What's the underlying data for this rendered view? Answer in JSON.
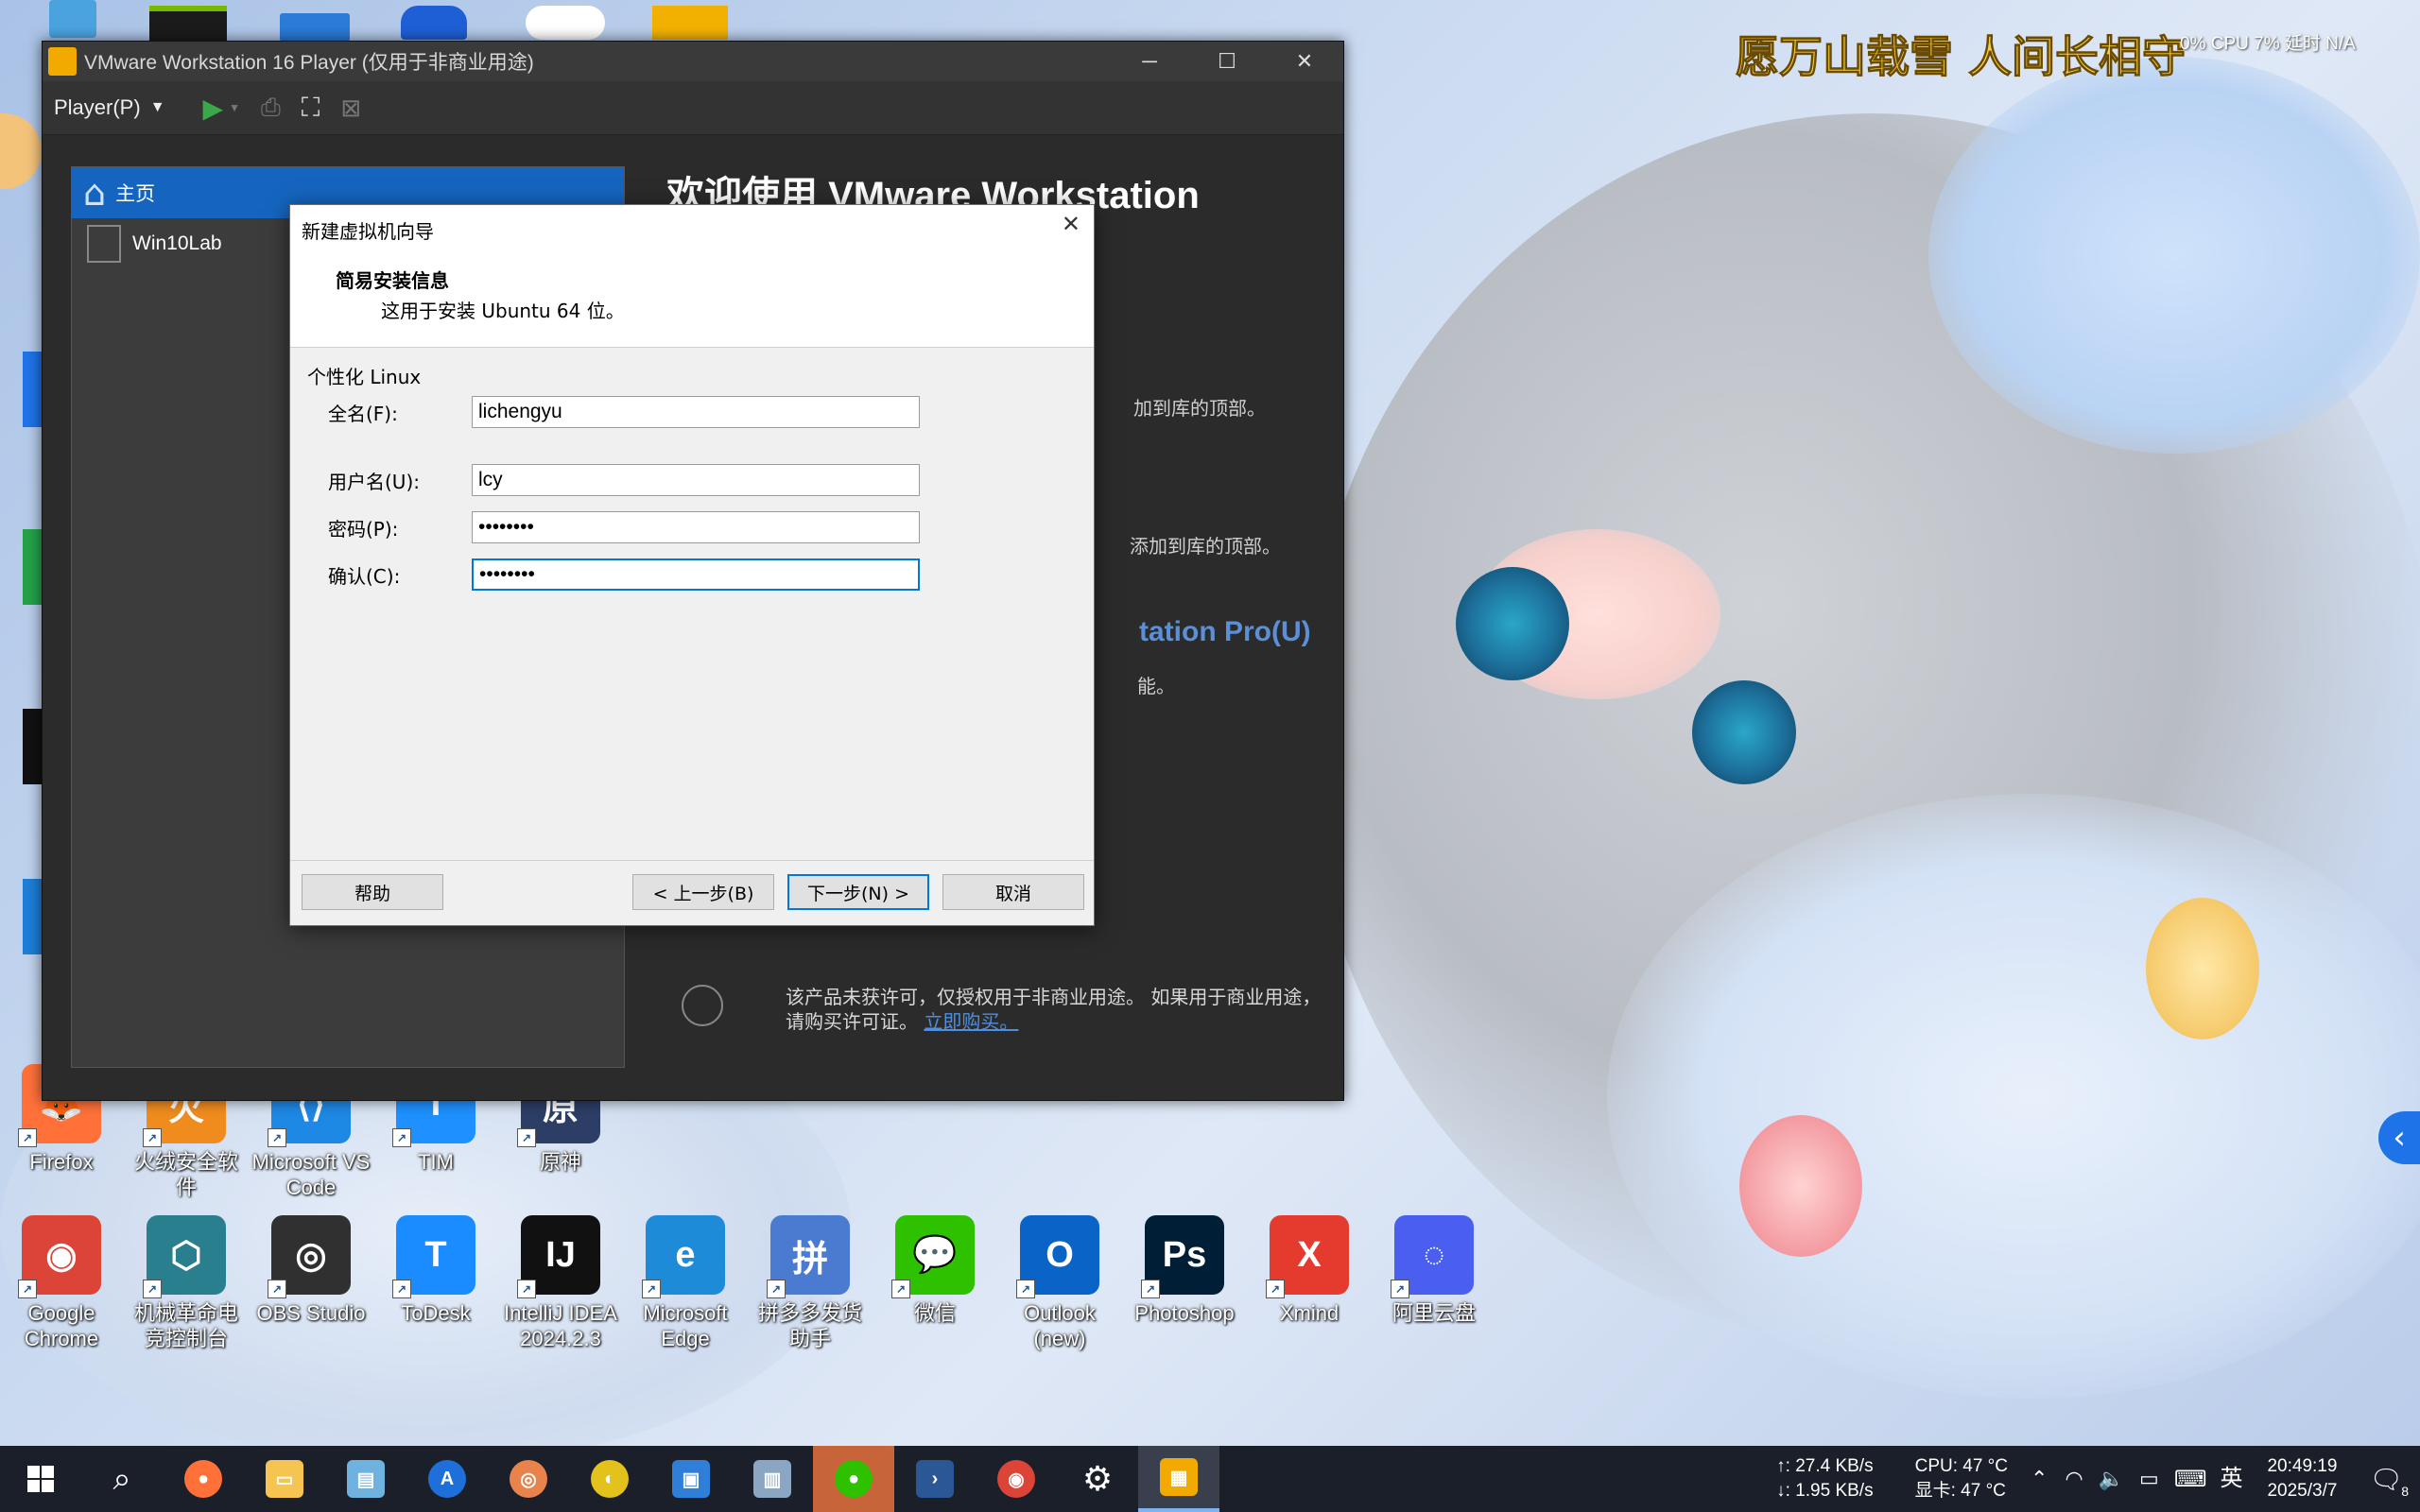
{
  "overlay": {
    "poem": "愿万山载雪 人间长相守",
    "stats": "0% CPU 7% 延时 N/A"
  },
  "desktop_icons_row1": [
    {
      "label": "Firefox",
      "color": "#ff7139",
      "glyph": "🦊"
    },
    {
      "label": "火绒安全软件",
      "color": "#f08c1e",
      "glyph": "火"
    },
    {
      "label": "Microsoft VS Code",
      "color": "#1e88e5",
      "glyph": "⟨⟩"
    },
    {
      "label": "TIM",
      "color": "#1e90ff",
      "glyph": "T"
    },
    {
      "label": "原神",
      "color": "#2c3e66",
      "glyph": "原"
    }
  ],
  "desktop_icons_row2": [
    {
      "label": "Google Chrome",
      "color": "#db4437",
      "glyph": "◉"
    },
    {
      "label": "机械革命电竞控制台",
      "color": "#2a7f8f",
      "glyph": "⬡"
    },
    {
      "label": "OBS Studio",
      "color": "#303030",
      "glyph": "◎"
    },
    {
      "label": "ToDesk",
      "color": "#1a8cff",
      "glyph": "T"
    },
    {
      "label": "IntelliJ IDEA 2024.2.3",
      "color": "#111111",
      "glyph": "IJ"
    },
    {
      "label": "Microsoft Edge",
      "color": "#1d8bd8",
      "glyph": "e"
    },
    {
      "label": "拼多多发货助手",
      "color": "#4a7bd0",
      "glyph": "拼"
    },
    {
      "label": "微信",
      "color": "#2dc100",
      "glyph": "💬"
    },
    {
      "label": "Outlook (new)",
      "color": "#0a64c8",
      "glyph": "O"
    },
    {
      "label": "Photoshop",
      "color": "#001e36",
      "glyph": "Ps"
    },
    {
      "label": "Xmind",
      "color": "#e53b2f",
      "glyph": "X"
    },
    {
      "label": "阿里云盘",
      "color": "#4a5ff0",
      "glyph": "◌"
    }
  ],
  "vmware": {
    "title": "VMware Workstation 16 Player (仅用于非商业用途)",
    "player_menu": "Player(P)",
    "library": {
      "home": "主页",
      "vm": "Win10Lab"
    },
    "welcome": "欢迎使用 VMware Workstation",
    "snippet1": "加到库的顶部。",
    "snippet2": "添加到库的顶部。",
    "pro_title": "tation Pro(U)",
    "snippet3": "能。",
    "license_text": "该产品未获许可，仅授权用于非商业用途。 如果用于商业用途，请购买许可证。",
    "buy_link": "立即购买。"
  },
  "dialog": {
    "title": "新建虚拟机向导",
    "heading": "简易安装信息",
    "subheading": "这用于安装 Ubuntu 64 位。",
    "section": "个性化 Linux",
    "fields": {
      "fullname_label": "全名(F):",
      "fullname_value": "lichengyu",
      "username_label": "用户名(U):",
      "username_value": "lcy",
      "password_label": "密码(P):",
      "password_value": "••••••••",
      "confirm_label": "确认(C):",
      "confirm_value": "••••••••"
    },
    "buttons": {
      "help": "帮助",
      "back": "< 上一步(B)",
      "next": "下一步(N) >",
      "cancel": "取消"
    }
  },
  "taskbar": {
    "net_up": "↑: 27.4 KB/s",
    "net_down": "↓: 1.95 KB/s",
    "cpu_temp": "CPU: 47 °C",
    "gpu_temp": "显卡: 47 °C",
    "ime": "英",
    "time": "20:49:19",
    "date": "2025/3/7",
    "notifications": "8"
  }
}
